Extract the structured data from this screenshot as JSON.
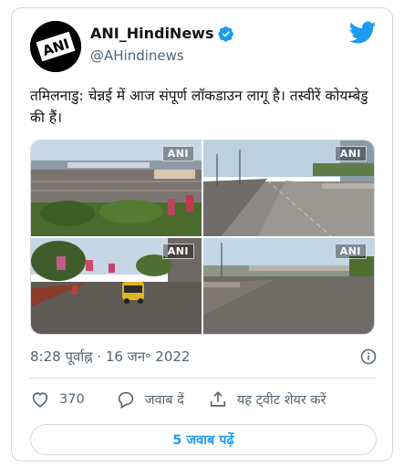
{
  "author": {
    "display_name": "ANI_HindiNews",
    "handle": "@AHindinews",
    "avatar_text": "ANI",
    "verified": true
  },
  "tweet": {
    "text": "तमिलनाडु: चेन्नई में आज संपूर्ण लॉकडाउन लागू है। तस्वीरें कोयम्बेडु की हैं।",
    "timestamp": "8:28 पूर्वाह्न · 16 जन॰ 2022"
  },
  "media": [
    {
      "watermark": "ANI",
      "scene": "bus-terminus-empty"
    },
    {
      "watermark": "ANI",
      "scene": "empty-flyover-road"
    },
    {
      "watermark": "ANI",
      "scene": "street-with-auto-rickshaw"
    },
    {
      "watermark": "ANI",
      "scene": "empty-junction"
    }
  ],
  "actions": {
    "like_count": "370",
    "reply_label": "जवाब दें",
    "share_label": "यह ट्वीट शेयर करें"
  },
  "replies_button_label": "5 जवाब पढ़ें",
  "colors": {
    "brand_blue": "#1d9bf0",
    "muted_text": "#536471",
    "border": "#cfd9de"
  },
  "icons": [
    "twitter-bird-icon",
    "verified-badge-icon",
    "info-icon",
    "heart-icon",
    "reply-bubble-icon",
    "share-icon"
  ]
}
